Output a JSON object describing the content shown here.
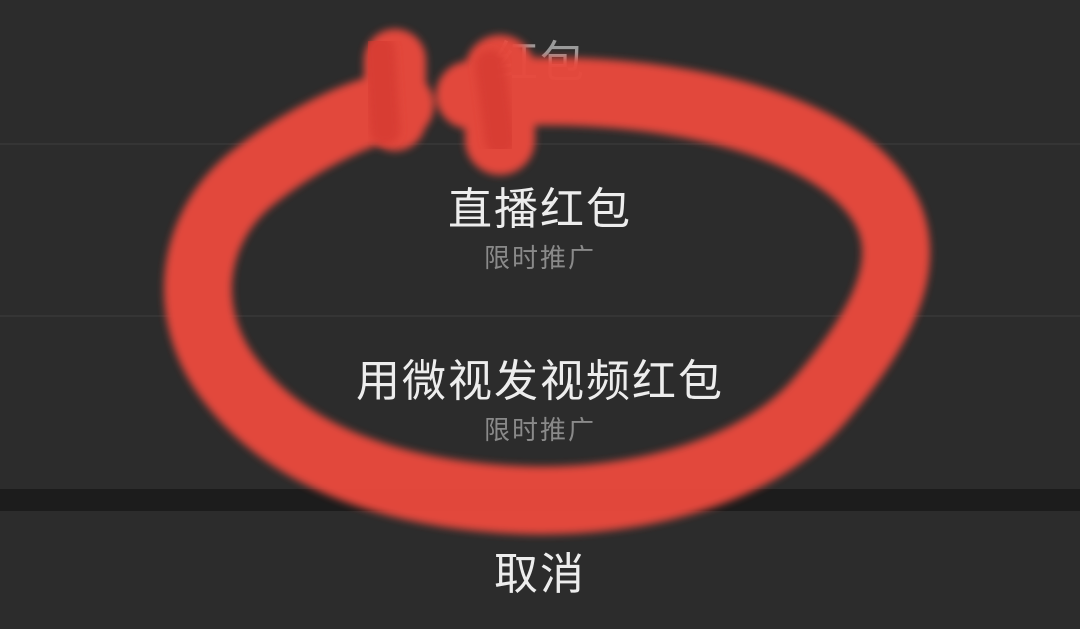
{
  "menu": {
    "items": [
      {
        "title": "红包",
        "subtitle": ""
      },
      {
        "title": "直播红包",
        "subtitle": "限时推广"
      },
      {
        "title": "用微视发视频红包",
        "subtitle": "限时推广"
      }
    ],
    "cancel_label": "取消"
  },
  "annotation": {
    "type": "hand-drawn red loop highlight",
    "color": "#e84a3d"
  }
}
